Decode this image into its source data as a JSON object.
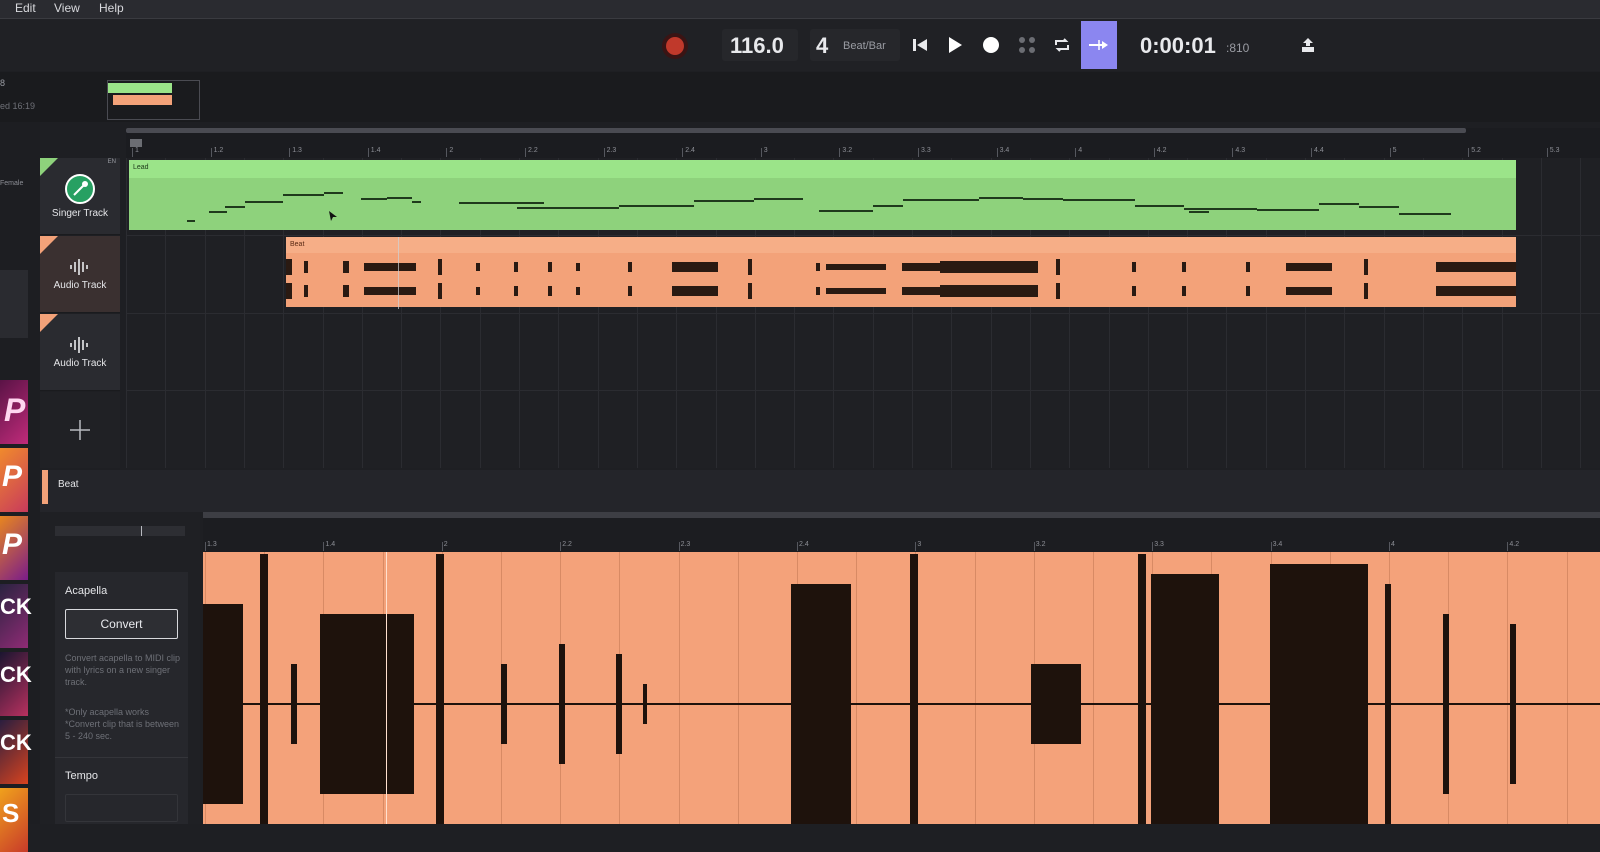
{
  "menu": {
    "edit": "Edit",
    "view": "View",
    "help": "Help"
  },
  "transport": {
    "tempo": "116.0",
    "time_sig": "4",
    "beat_bar_label": "Beat/Bar",
    "time_main": "0:00:01",
    "time_ms": ":810"
  },
  "project": {
    "name_fragment": "8",
    "saved_fragment": "ed 16:19"
  },
  "left_edge": {
    "voice_fragment": "Female",
    "thumb_letters": [
      "P",
      "P",
      "P",
      "CK",
      "CK",
      "CK",
      "S"
    ]
  },
  "tracks": [
    {
      "name": "Singer Track",
      "color": "#8ed27c",
      "tag": "EN"
    },
    {
      "name": "Audio Track",
      "color": "#f3a279"
    },
    {
      "name": "Audio Track",
      "color": "#f3a279"
    }
  ],
  "clips": {
    "lead": "Lead",
    "beat": "Beat"
  },
  "ruler_labels": [
    "1",
    "1.2",
    "1.3",
    "1.4",
    "2",
    "2.2",
    "2.3",
    "2.4",
    "3",
    "3.2",
    "3.3",
    "3.4",
    "4",
    "4.2",
    "4.3",
    "4.4",
    "5",
    "5.2",
    "5.3"
  ],
  "editor": {
    "clip_name": "Beat",
    "ruler_labels": [
      "1.3",
      "1.4",
      "2",
      "2.2",
      "2.3",
      "2.4",
      "3",
      "3.2",
      "3.3",
      "3.4",
      "4",
      "4.2"
    ],
    "acapella_title": "Acapella",
    "convert_label": "Convert",
    "help_text": "Convert acapella to MIDI clip with lyrics on a new singer track.",
    "note1": "*Only acapella works",
    "note2": "*Convert clip that is between 5 - 240 sec.",
    "tempo_title": "Tempo"
  },
  "colors": {
    "accent": "#8b86f0",
    "singer": "#8ed27c",
    "audio": "#f3a279",
    "record": "#c0392b"
  }
}
